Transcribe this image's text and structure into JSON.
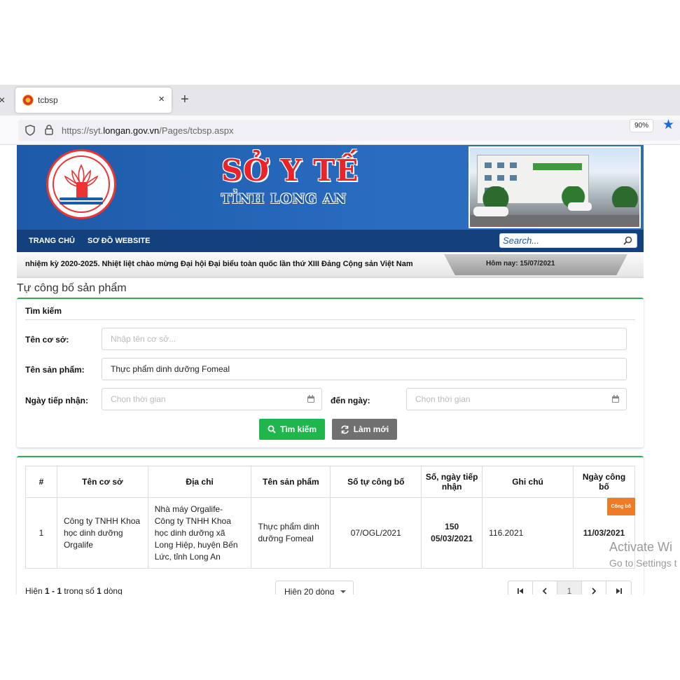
{
  "browser": {
    "tab_title": "tcbsp",
    "url_prefix": "https://syt.",
    "url_domain": "longan.gov.vn",
    "url_path": "/Pages/tcbsp.aspx",
    "zoom": "90%",
    "new_tab": "+",
    "close": "×"
  },
  "header": {
    "title": "SỞ Y TẾ",
    "subtitle": "TỈNH LONG AN"
  },
  "nav": {
    "items": [
      "TRANG CHỦ",
      "SƠ ĐỒ WEBSITE"
    ],
    "search_placeholder": "Search..."
  },
  "ticker": {
    "text": "nhiệm kỳ 2020-2025.     Nhiệt liệt chào mừng Đại hội Đại biểu toàn quốc lần thứ XIII Đảng Cộng sản Việt Nam",
    "today": "Hôm nay: 15/07/2021"
  },
  "page_title": "Tự công bố sản phẩm",
  "search_form": {
    "heading": "Tìm kiếm",
    "facility_label": "Tên cơ sở:",
    "facility_placeholder": "Nhập tên cơ sở...",
    "facility_value": "",
    "product_label": "Tên sản phẩm:",
    "product_value": "Thực phẩm dinh dưỡng Fomeal",
    "date_label": "Ngày tiếp nhận:",
    "date_from_placeholder": "Chọn thời gian",
    "date_to_label": "đến ngày:",
    "date_to_placeholder": "Chọn thời gian",
    "search_button": "Tìm kiếm",
    "reset_button": "Làm mới"
  },
  "table": {
    "headers": [
      "#",
      "Tên cơ sở",
      "Địa chỉ",
      "Tên sản phẩm",
      "Số tự công bố",
      "Số, ngày tiếp nhận",
      "Ghi chú",
      "Ngày công bố"
    ],
    "rows": [
      {
        "index": "1",
        "facility": "Công ty TNHH Khoa học dinh dưỡng Orgalife",
        "address": "Nhà máy Orgalife- Công ty TNHH Khoa học dinh dưỡng xã Long Hiệp, huyện Bến Lức, tỉnh Long An",
        "product": "Thực phẩm dinh dưỡng Fomeal",
        "declaration_no": "07/OGL/2021",
        "receipt_no": "150",
        "receipt_date": "05/03/2021",
        "note": "116.2021",
        "publish_date": "11/03/2021",
        "badge": "Công bố"
      }
    ]
  },
  "footer": {
    "info_prefix": "Hiện ",
    "info_range": "1 - 1",
    "info_mid": " trong số ",
    "info_total": "1",
    "info_suffix": " dòng",
    "page_size": "Hiện 20 dòng",
    "current_page": "1"
  },
  "watermark": {
    "line1": "Activate Wi",
    "line2": "Go to Settings t"
  }
}
